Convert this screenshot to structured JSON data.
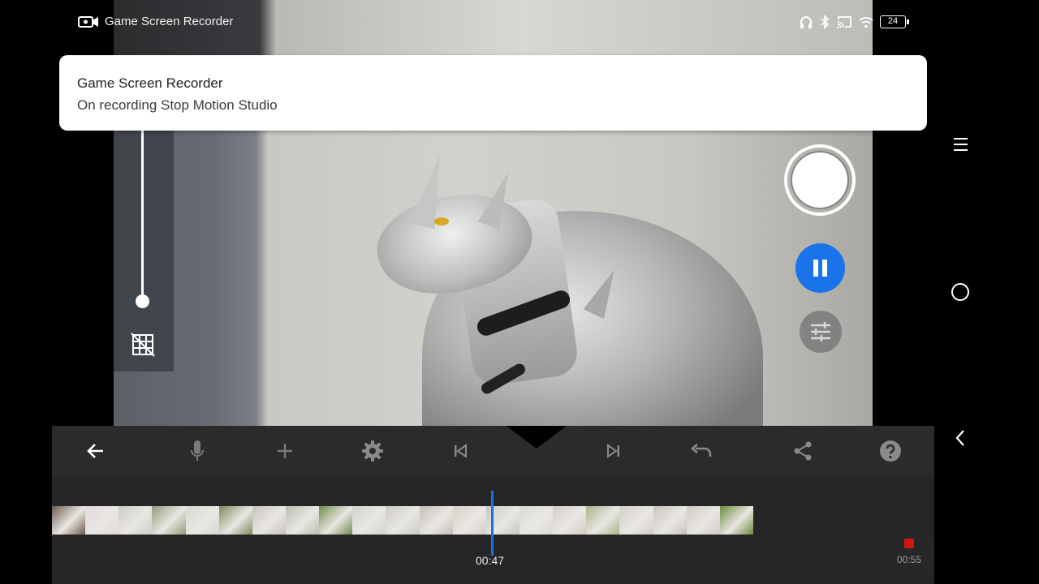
{
  "status_bar": {
    "app_name": "Game Screen Recorder",
    "battery": "24",
    "icons": [
      "headphones-icon",
      "bluetooth-icon",
      "cast-icon",
      "wifi-icon",
      "battery-icon"
    ]
  },
  "notification": {
    "title": "Game Screen Recorder",
    "body": "On recording Stop Motion Studio"
  },
  "camera": {
    "exposure_slider_level": 0.0,
    "controls": [
      "capture-button",
      "pause-button",
      "adjust-button",
      "grid-toggle"
    ]
  },
  "toolbar": {
    "items": [
      "back",
      "microphone",
      "add",
      "settings",
      "skip-previous",
      "skip-next",
      "undo",
      "share",
      "help"
    ]
  },
  "timeline": {
    "current_time": "00:47",
    "frame_colors": [
      "#6d5a4f",
      "#e3d9de",
      "#c9cfc6",
      "#8f9c7a",
      "#d8d8d6",
      "#7d8c5e",
      "#c7c3bd",
      "#b8c0b0",
      "#6f8a4c",
      "#d4d2cd",
      "#cdcac4",
      "#c4bfb7",
      "#d5d1c6",
      "#c9c7bf",
      "#dcdad3",
      "#d2cec5",
      "#a9b48a",
      "#d3d0c8",
      "#c8c4bc",
      "#d0ccc4",
      "#6b8a3c"
    ]
  },
  "recording": {
    "elapsed": "00:55",
    "dot_color": "#d01515"
  },
  "system_nav": {
    "items": [
      "menu-icon",
      "home-icon",
      "back-icon"
    ]
  },
  "colors": {
    "accent": "#1a73e8",
    "toolbar_bg": "#2b2b2b",
    "timeline_bg": "#262626"
  }
}
